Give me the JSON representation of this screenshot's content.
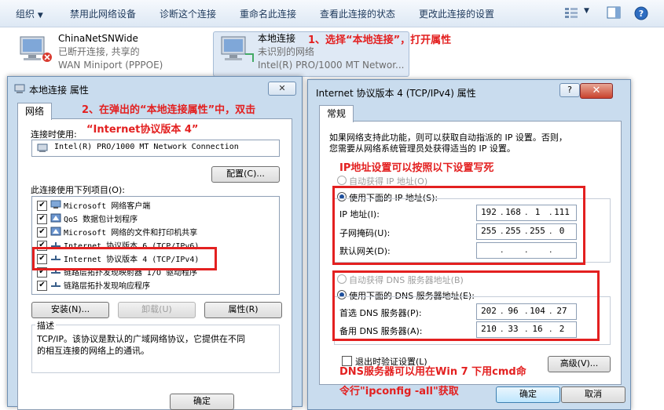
{
  "toolbar": {
    "organize": "组织",
    "disable": "禁用此网络设备",
    "diagnose": "诊断这个连接",
    "rename": "重命名此连接",
    "view_status": "查看此连接的状态",
    "change_settings": "更改此连接的设置"
  },
  "connections": [
    {
      "name": "ChinaNetSNWide",
      "status": "已断开连接, 共享的",
      "device": "WAN Miniport (PPPOE)"
    },
    {
      "name": "本地连接",
      "status": "未识别的网络",
      "device": "Intel(R) PRO/1000 MT Networ..."
    }
  ],
  "annotations": {
    "step1": "1、选择“本地连接”，打开属性",
    "step2a": "2、在弹出的“本地连接属性”中，双击",
    "step2b": "“Internet协议版本 4”",
    "ip_note": "IP地址设置可以按照以下设置写死",
    "dns_note1": "DNS服务器可以用在Win 7 下用cmd命",
    "dns_note2": "令行\"ipconfig -all\"获取"
  },
  "props_dialog": {
    "title": "本地连接 属性",
    "tab": "网络",
    "connect_using_label": "连接时使用:",
    "adapter": "Intel(R) PRO/1000 MT Network Connection",
    "configure": "配置(C)...",
    "items_label": "此连接使用下列项目(O):",
    "items": [
      {
        "checked": "✔",
        "label": "Microsoft 网络客户端"
      },
      {
        "checked": "✔",
        "label": "QoS 数据包计划程序"
      },
      {
        "checked": "✔",
        "label": "Microsoft 网络的文件和打印机共享"
      },
      {
        "checked": "✔",
        "label": "Internet 协议版本 6 (TCP/IPv6)"
      },
      {
        "checked": "✔",
        "label": "Internet 协议版本 4 (TCP/IPv4)"
      },
      {
        "checked": "✔",
        "label": "链路层拓扑发现映射器 I/O 驱动程序"
      },
      {
        "checked": "✔",
        "label": "链路层拓扑发现响应程序"
      }
    ],
    "install": "安装(N)...",
    "uninstall": "卸载(U)",
    "properties": "属性(R)",
    "desc_label": "描述",
    "desc_text1": "TCP/IP。该协议是默认的广域网络协议，它提供在不同",
    "desc_text2": "的相互连接的网络上的通讯。",
    "ok": "确定"
  },
  "ipv4_dialog": {
    "title": "Internet 协议版本 4 (TCP/IPv4) 属性",
    "tab": "常规",
    "intro1": "如果网络支持此功能，则可以获取自动指派的 IP 设置。否则，",
    "intro2": "您需要从网络系统管理员处获得适当的 IP 设置。",
    "auto_ip": "自动获得 IP 地址(O)",
    "use_ip": "使用下面的 IP 地址(S):",
    "ip_label": "IP 地址(I):",
    "mask_label": "子网掩码(U):",
    "gateway_label": "默认网关(D):",
    "ip": [
      "192",
      "168",
      "1",
      "111"
    ],
    "mask": [
      "255",
      "255",
      "255",
      "0"
    ],
    "gateway": [
      "",
      "",
      "",
      ""
    ],
    "auto_dns": "自动获得 DNS 服务器地址(B)",
    "use_dns": "使用下面的 DNS 服务器地址(E):",
    "dns1_label": "首选 DNS 服务器(P):",
    "dns2_label": "备用 DNS 服务器(A):",
    "dns1": [
      "202",
      "96",
      "104",
      "27"
    ],
    "dns2": [
      "210",
      "33",
      "16",
      "2"
    ],
    "validate": "退出时验证设置(L)",
    "advanced": "高级(V)...",
    "ok": "确定",
    "cancel": "取消"
  },
  "colors": {
    "annotation": "#e32020",
    "dialog_frame": "#c9dcee"
  }
}
